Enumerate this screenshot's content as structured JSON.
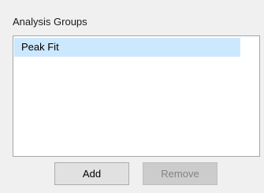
{
  "panel": {
    "title": "Analysis Groups"
  },
  "list": {
    "items": [
      {
        "label": "Peak Fit",
        "selected": true
      }
    ]
  },
  "buttons": {
    "add_label": "Add",
    "remove_label": "Remove",
    "remove_enabled": false
  },
  "colors": {
    "selection": "#cce8ff",
    "window_background": "#f0f0f0",
    "disabled_text": "#838383"
  }
}
